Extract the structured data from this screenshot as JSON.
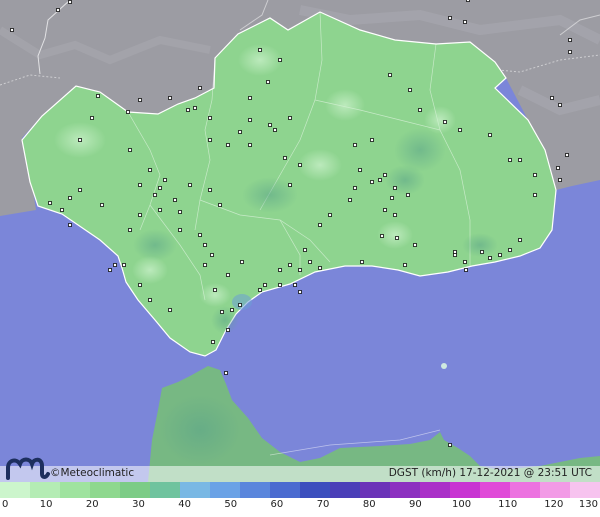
{
  "product_caption": "DGST (km/h)  17-12-2021 @ 23:51 UTC",
  "brand": {
    "label": "©Meteoclimatic",
    "logo_icon": "meteoclimatic-m-logo-icon"
  },
  "colors": {
    "sea": "#7b86d9",
    "land_outside": "#9c9ca3",
    "region_fill": "#8ed48f",
    "region_dark": "#6fbf8a",
    "africa_fill": "#77b883"
  },
  "legend": {
    "ticks": [
      "0",
      "10",
      "20",
      "30",
      "40",
      "50",
      "60",
      "70",
      "80",
      "90",
      "100",
      "110",
      "120",
      "130"
    ],
    "colors": [
      "#ccf5cc",
      "#b4ecb4",
      "#9fe39f",
      "#8ed88e",
      "#7ccc86",
      "#6fc39e",
      "#79b8e4",
      "#6aa2e6",
      "#5a86dc",
      "#4a6bd0",
      "#3c4fbe",
      "#4a3fb8",
      "#6b33b8",
      "#8c30c0",
      "#aa30c8",
      "#c834d2",
      "#e04ad8",
      "#ec72e0",
      "#f29ae6",
      "#f7c3ef"
    ]
  }
}
